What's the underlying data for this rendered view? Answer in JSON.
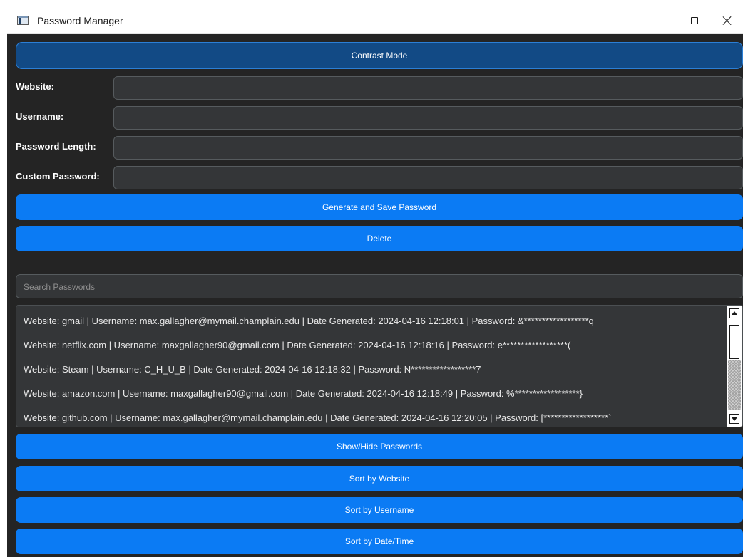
{
  "window": {
    "title": "Password Manager"
  },
  "buttons": {
    "contrast_mode": "Contrast Mode",
    "generate_save": "Generate and Save Password",
    "delete": "Delete",
    "show_hide": "Show/Hide Passwords",
    "sort_website": "Sort by Website",
    "sort_username": "Sort by Username",
    "sort_datetime": "Sort by Date/Time"
  },
  "form": {
    "website_label": "Website:",
    "username_label": "Username:",
    "password_length_label": "Password Length:",
    "custom_password_label": "Custom Password:",
    "website_value": "",
    "username_value": "",
    "password_length_value": "",
    "custom_password_value": ""
  },
  "search": {
    "placeholder": "Search Passwords",
    "value": ""
  },
  "entries": [
    "Website: gmail | Username: max.gallagher@mymail.champlain.edu | Date Generated: 2024-04-16 12:18:01 | Password: &******************q",
    "Website: netflix.com | Username: maxgallagher90@gmail.com | Date Generated: 2024-04-16 12:18:16 | Password: e******************(",
    "Website: Steam | Username: C_H_U_B | Date Generated: 2024-04-16 12:18:32 | Password: N******************7",
    "Website: amazon.com | Username: maxgallagher90@gmail.com | Date Generated: 2024-04-16 12:18:49 | Password: %******************}",
    "Website: github.com | Username: max.gallagher@mymail.champlain.edu | Date Generated: 2024-04-16 12:20:05 | Password: [******************`"
  ],
  "colors": {
    "background": "#242424",
    "button": "#0b7bf4",
    "contrast_button": "#124a85",
    "entry_bg": "#343638",
    "entry_border": "#565b5e"
  }
}
